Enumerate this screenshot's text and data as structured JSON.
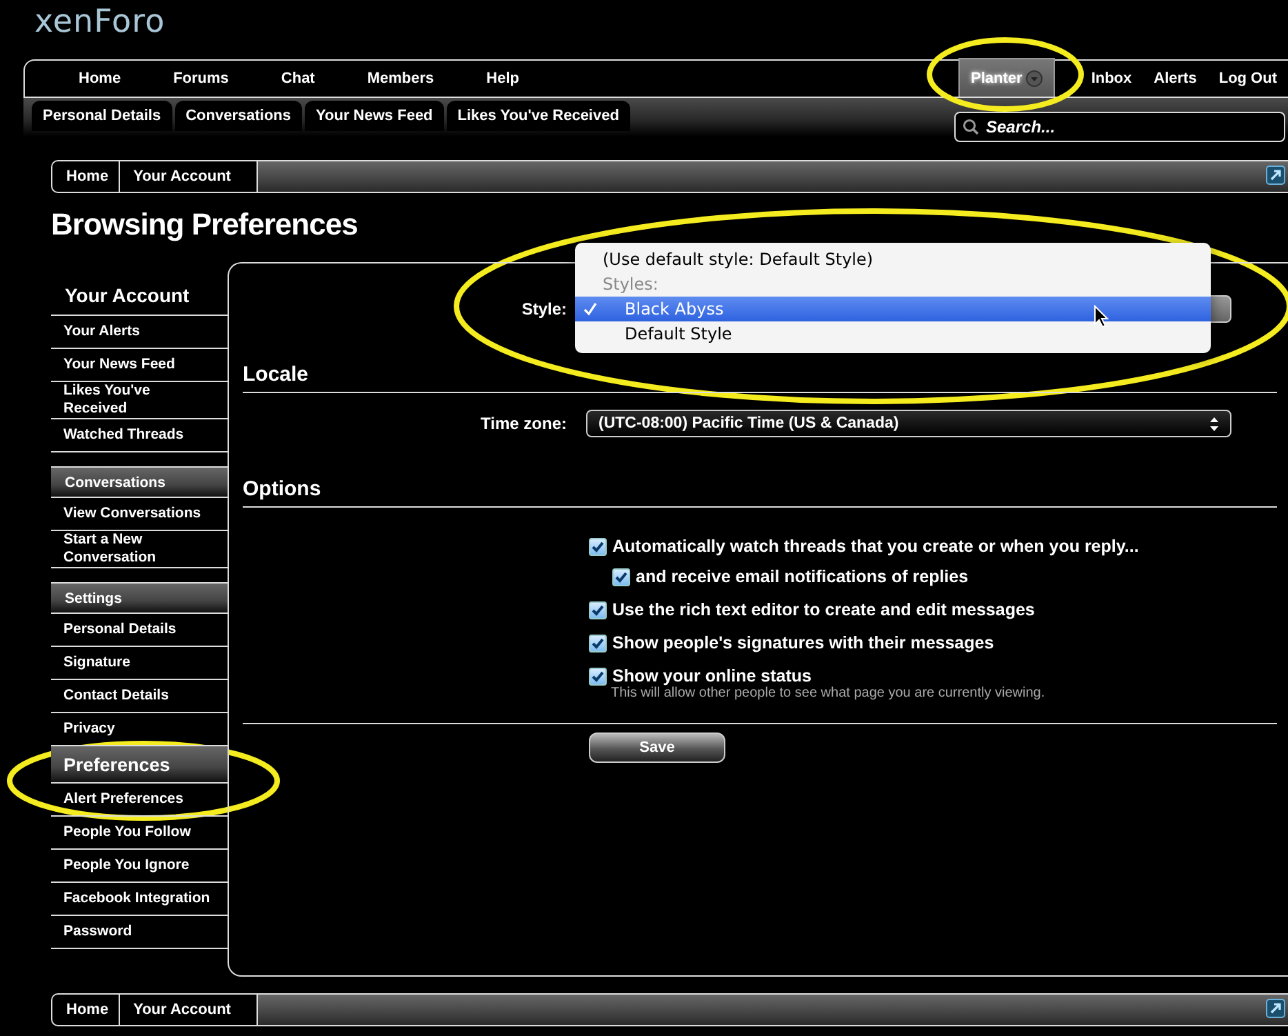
{
  "logo": {
    "text": "xenForo"
  },
  "nav": {
    "tabs": [
      {
        "label": "Home",
        "selected": false
      },
      {
        "label": "Forums",
        "selected": false
      },
      {
        "label": "Chat",
        "selected": false
      },
      {
        "label": "Members",
        "selected": false
      },
      {
        "label": "Help",
        "selected": false
      }
    ],
    "user_tabs": [
      {
        "label": "Planter",
        "selected": true,
        "has_menu": true
      },
      {
        "label": "Inbox",
        "selected": false,
        "has_menu": false
      },
      {
        "label": "Alerts",
        "selected": false,
        "has_menu": false
      },
      {
        "label": "Log Out",
        "selected": false,
        "has_menu": false
      }
    ]
  },
  "subnav": [
    {
      "label": "Personal Details"
    },
    {
      "label": "Conversations"
    },
    {
      "label": "Your News Feed"
    },
    {
      "label": "Likes You've Received"
    }
  ],
  "search": {
    "placeholder": "Search..."
  },
  "breadcrumb_top": [
    "Home",
    "Your Account"
  ],
  "page_title": "Browsing Preferences",
  "sidebar": [
    {
      "heading": "Your Account",
      "kind": "title",
      "items": [
        {
          "label": "Your Alerts",
          "selected": false
        },
        {
          "label": "Your News Feed",
          "selected": false
        },
        {
          "label": "Likes You've Received",
          "selected": false
        },
        {
          "label": "Watched Threads",
          "selected": false
        }
      ]
    },
    {
      "heading": "Conversations",
      "kind": "group",
      "items": [
        {
          "label": "View Conversations",
          "selected": false
        },
        {
          "label": "Start a New Conversation",
          "selected": false
        }
      ]
    },
    {
      "heading": "Settings",
      "kind": "group",
      "items": [
        {
          "label": "Personal Details",
          "selected": false
        },
        {
          "label": "Signature",
          "selected": false
        },
        {
          "label": "Contact Details",
          "selected": false
        },
        {
          "label": "Privacy",
          "selected": false
        },
        {
          "label": "Preferences",
          "selected": true
        },
        {
          "label": "Alert Preferences",
          "selected": false
        },
        {
          "label": "People You Follow",
          "selected": false
        },
        {
          "label": "People You Ignore",
          "selected": false
        },
        {
          "label": "Facebook Integration",
          "selected": false
        },
        {
          "label": "Password",
          "selected": false
        }
      ]
    }
  ],
  "style": {
    "label": "Style:",
    "options": [
      {
        "text": "(Use default style: Default Style)",
        "kind": "option",
        "selected": false
      },
      {
        "text": "Styles:",
        "kind": "header",
        "selected": false
      },
      {
        "text": "Black Abyss",
        "kind": "option",
        "selected": true
      },
      {
        "text": "Default Style",
        "kind": "option",
        "selected": false
      }
    ]
  },
  "locale": {
    "heading": "Locale",
    "label": "Time zone:",
    "value": "(UTC-08:00) Pacific Time (US & Canada)"
  },
  "options": {
    "heading": "Options",
    "items": [
      {
        "label": "Automatically watch threads that you create or when you reply...",
        "checked": true,
        "children": [
          {
            "label": "and receive email notifications of replies",
            "checked": true
          }
        ]
      },
      {
        "label": "Use the rich text editor to create and edit messages",
        "checked": true
      },
      {
        "label": "Show people's signatures with their messages",
        "checked": true
      },
      {
        "label": "Show your online status",
        "checked": true,
        "hint": "This will allow other people to see what page you are currently viewing."
      }
    ]
  },
  "save": {
    "label": "Save"
  },
  "breadcrumb_bottom": [
    "Home",
    "Your Account"
  ]
}
